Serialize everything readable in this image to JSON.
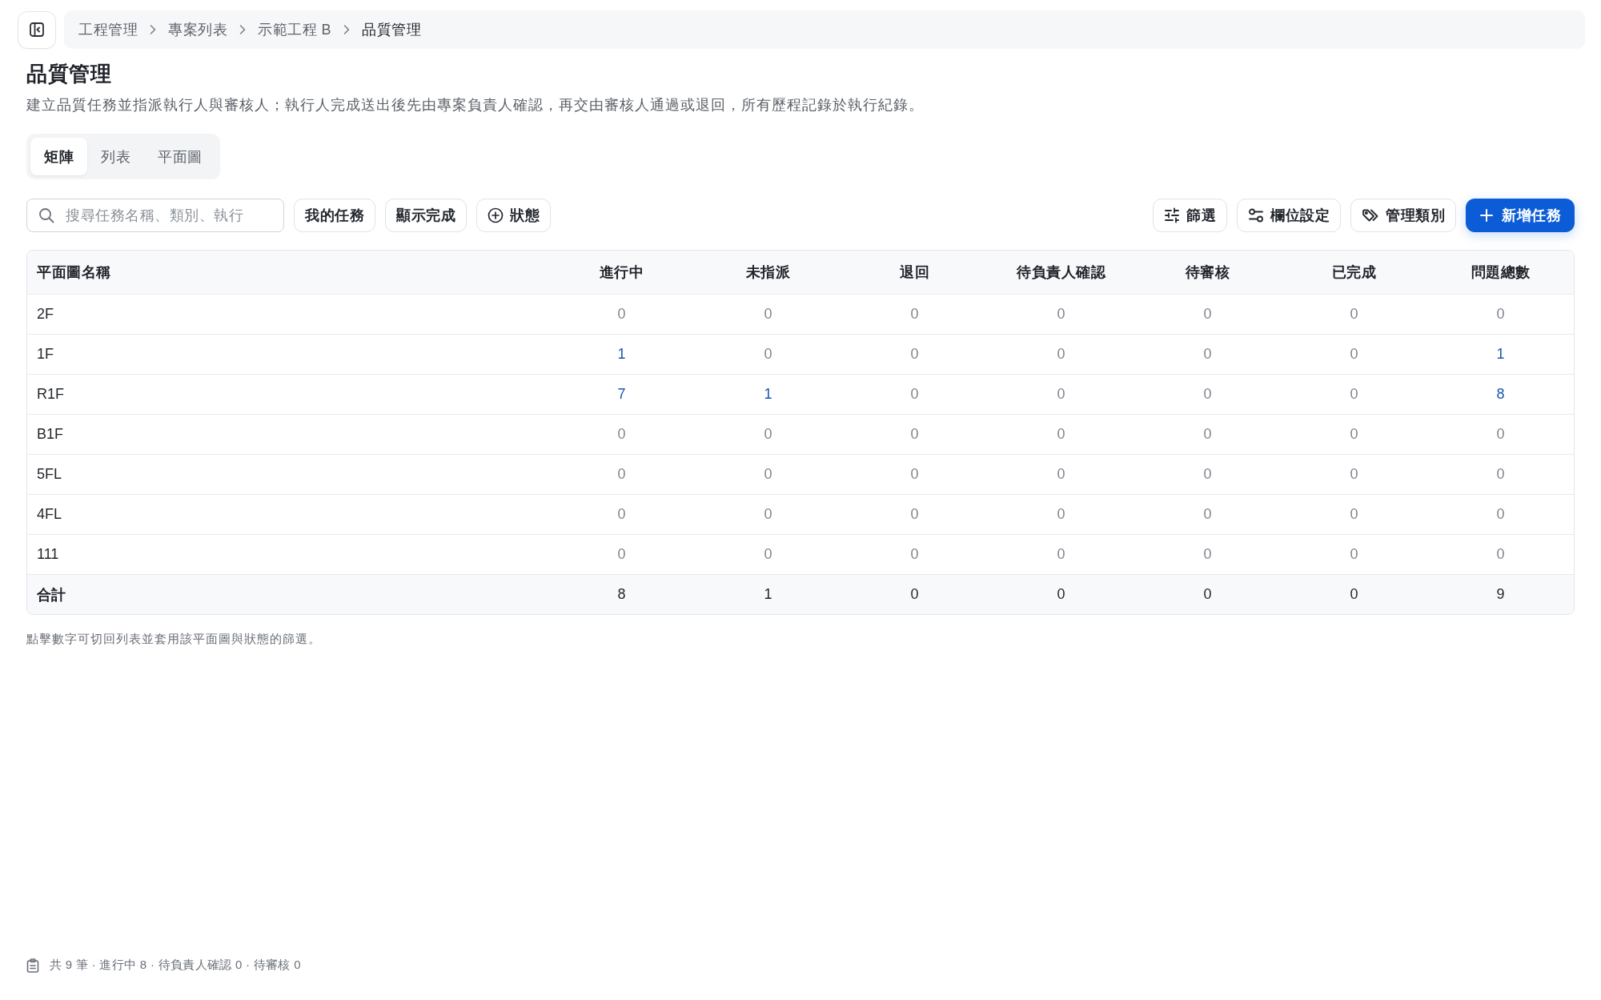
{
  "breadcrumb": [
    {
      "label": "工程管理",
      "current": false
    },
    {
      "label": "專案列表",
      "current": false
    },
    {
      "label": "示範工程 B",
      "current": false
    },
    {
      "label": "品質管理",
      "current": true
    }
  ],
  "page": {
    "title": "品質管理",
    "description": "建立品質任務並指派執行人與審核人；執行人完成送出後先由專案負責人確認，再交由審核人通過或退回，所有歷程記錄於執行紀錄。"
  },
  "view_tabs": [
    {
      "label": "矩陣",
      "selected": true
    },
    {
      "label": "列表",
      "selected": false
    },
    {
      "label": "平面圖",
      "selected": false
    }
  ],
  "toolbar": {
    "search": {
      "placeholder": "搜尋任務名稱、類別、執行"
    },
    "filters": [
      {
        "label": "我的任務"
      },
      {
        "label": "顯示完成"
      },
      {
        "label": "狀態"
      }
    ],
    "actions": [
      {
        "label": "篩選",
        "kind": "default"
      },
      {
        "label": "欄位設定",
        "kind": "default"
      },
      {
        "label": "管理類別",
        "kind": "default"
      },
      {
        "label": "新增任務",
        "kind": "primary"
      }
    ]
  },
  "table": {
    "columns": [
      "平面圖名稱",
      "進行中",
      "未指派",
      "退回",
      "待負責人確認",
      "待審核",
      "已完成",
      "問題總數"
    ],
    "rows": [
      {
        "cells": [
          {
            "value": "2F"
          },
          {
            "value": "0",
            "linked": false
          },
          {
            "value": "0",
            "linked": false
          },
          {
            "value": "0",
            "linked": false
          },
          {
            "value": "0",
            "linked": false
          },
          {
            "value": "0",
            "linked": false
          },
          {
            "value": "0",
            "linked": false
          },
          {
            "value": "0",
            "linked": false
          }
        ]
      },
      {
        "cells": [
          {
            "value": "1F"
          },
          {
            "value": "1",
            "linked": true
          },
          {
            "value": "0",
            "linked": false
          },
          {
            "value": "0",
            "linked": false
          },
          {
            "value": "0",
            "linked": false
          },
          {
            "value": "0",
            "linked": false
          },
          {
            "value": "0",
            "linked": false
          },
          {
            "value": "1",
            "linked": true
          }
        ]
      },
      {
        "cells": [
          {
            "value": "R1F"
          },
          {
            "value": "7",
            "linked": true
          },
          {
            "value": "1",
            "linked": true
          },
          {
            "value": "0",
            "linked": false
          },
          {
            "value": "0",
            "linked": false
          },
          {
            "value": "0",
            "linked": false
          },
          {
            "value": "0",
            "linked": false
          },
          {
            "value": "8",
            "linked": true
          }
        ]
      },
      {
        "cells": [
          {
            "value": "B1F"
          },
          {
            "value": "0",
            "linked": false
          },
          {
            "value": "0",
            "linked": false
          },
          {
            "value": "0",
            "linked": false
          },
          {
            "value": "0",
            "linked": false
          },
          {
            "value": "0",
            "linked": false
          },
          {
            "value": "0",
            "linked": false
          },
          {
            "value": "0",
            "linked": false
          }
        ]
      },
      {
        "cells": [
          {
            "value": "5FL"
          },
          {
            "value": "0",
            "linked": false
          },
          {
            "value": "0",
            "linked": false
          },
          {
            "value": "0",
            "linked": false
          },
          {
            "value": "0",
            "linked": false
          },
          {
            "value": "0",
            "linked": false
          },
          {
            "value": "0",
            "linked": false
          },
          {
            "value": "0",
            "linked": false
          }
        ]
      },
      {
        "cells": [
          {
            "value": "4FL"
          },
          {
            "value": "0",
            "linked": false
          },
          {
            "value": "0",
            "linked": false
          },
          {
            "value": "0",
            "linked": false
          },
          {
            "value": "0",
            "linked": false
          },
          {
            "value": "0",
            "linked": false
          },
          {
            "value": "0",
            "linked": false
          },
          {
            "value": "0",
            "linked": false
          }
        ]
      },
      {
        "cells": [
          {
            "value": "111"
          },
          {
            "value": "0",
            "linked": false
          },
          {
            "value": "0",
            "linked": false
          },
          {
            "value": "0",
            "linked": false
          },
          {
            "value": "0",
            "linked": false
          },
          {
            "value": "0",
            "linked": false
          },
          {
            "value": "0",
            "linked": false
          },
          {
            "value": "0",
            "linked": false
          }
        ]
      }
    ],
    "total": [
      "合計",
      "8",
      "1",
      "0",
      "0",
      "0",
      "0",
      "9"
    ]
  },
  "note": "點擊數字可切回列表並套用該平面圖與狀態的篩選。",
  "status_bar": {
    "summary": "共 9 筆 · 進行中 8 · 待負責人確認 0 · 待審核 0"
  }
}
